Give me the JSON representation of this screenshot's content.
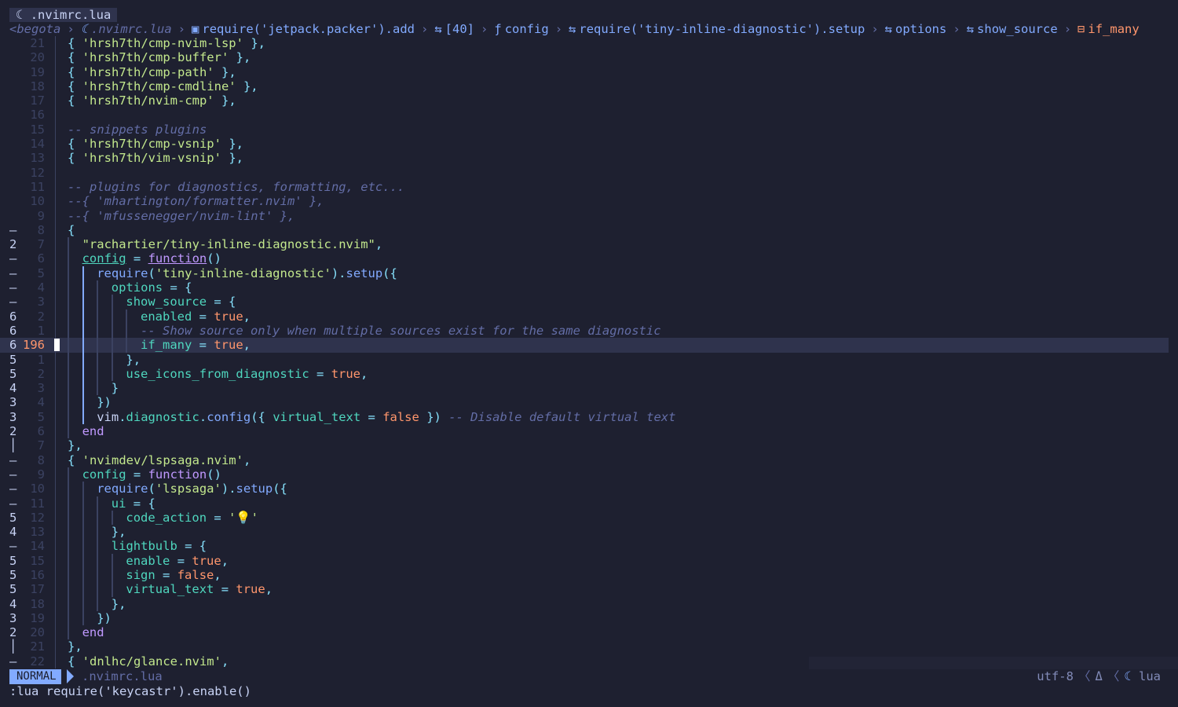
{
  "tab": {
    "title": ".nvimrc.lua"
  },
  "breadcrumb": {
    "items": [
      {
        "icon": "",
        "text": "<begota",
        "dim": true
      },
      {
        "icon": "lua-icon",
        "text": ".nvimrc.lua",
        "dim": true
      },
      {
        "icon": "module-icon",
        "text": "require('jetpack.packer').add"
      },
      {
        "icon": "struct-icon",
        "text": "[40]"
      },
      {
        "icon": "function-icon",
        "text": "config"
      },
      {
        "icon": "struct-icon",
        "text": "require('tiny-inline-diagnostic').setup"
      },
      {
        "icon": "struct-icon",
        "text": "options"
      },
      {
        "icon": "struct-icon",
        "text": "show_source"
      },
      {
        "icon": "boolean-icon",
        "text": "if_many",
        "last": true
      }
    ]
  },
  "lines": [
    {
      "l": "",
      "n": "21",
      "code": [
        {
          "c": "p",
          "t": "{ "
        },
        {
          "c": "s",
          "t": "'hrsh7th/cmp-nvim-lsp'"
        },
        {
          "c": "p",
          "t": " },"
        }
      ]
    },
    {
      "l": "",
      "n": "20",
      "code": [
        {
          "c": "p",
          "t": "{ "
        },
        {
          "c": "s",
          "t": "'hrsh7th/cmp-buffer'"
        },
        {
          "c": "p",
          "t": " },"
        }
      ]
    },
    {
      "l": "",
      "n": "19",
      "code": [
        {
          "c": "p",
          "t": "{ "
        },
        {
          "c": "s",
          "t": "'hrsh7th/cmp-path'"
        },
        {
          "c": "p",
          "t": " },"
        }
      ]
    },
    {
      "l": "",
      "n": "18",
      "code": [
        {
          "c": "p",
          "t": "{ "
        },
        {
          "c": "s",
          "t": "'hrsh7th/cmp-cmdline'"
        },
        {
          "c": "p",
          "t": " },"
        }
      ]
    },
    {
      "l": "",
      "n": "17",
      "code": [
        {
          "c": "p",
          "t": "{ "
        },
        {
          "c": "s",
          "t": "'hrsh7th/nvim-cmp'"
        },
        {
          "c": "p",
          "t": " },"
        }
      ]
    },
    {
      "l": "",
      "n": "16",
      "code": []
    },
    {
      "l": "",
      "n": "15",
      "code": [
        {
          "c": "c",
          "t": "-- snippets plugins"
        }
      ]
    },
    {
      "l": "",
      "n": "14",
      "code": [
        {
          "c": "p",
          "t": "{ "
        },
        {
          "c": "s",
          "t": "'hrsh7th/cmp-vsnip'"
        },
        {
          "c": "p",
          "t": " },"
        }
      ]
    },
    {
      "l": "",
      "n": "13",
      "code": [
        {
          "c": "p",
          "t": "{ "
        },
        {
          "c": "s",
          "t": "'hrsh7th/vim-vsnip'"
        },
        {
          "c": "p",
          "t": " },"
        }
      ]
    },
    {
      "l": "",
      "n": "12",
      "code": []
    },
    {
      "l": "",
      "n": "11",
      "code": [
        {
          "c": "c",
          "t": "-- plugins for diagnostics, formatting, etc..."
        }
      ]
    },
    {
      "l": "",
      "n": "10",
      "code": [
        {
          "c": "c",
          "t": "--{ 'mhartington/formatter.nvim' },"
        }
      ]
    },
    {
      "l": "",
      "n": "9",
      "code": [
        {
          "c": "c",
          "t": "--{ 'mfussenegger/nvim-lint' },"
        }
      ]
    },
    {
      "l": "–",
      "n": "8",
      "code": [
        {
          "c": "p",
          "t": "{"
        }
      ]
    },
    {
      "l": "2",
      "n": "7",
      "code": [
        {
          "c": "s",
          "t": "\"rachartier/tiny-inline-diagnostic.nvim\""
        },
        {
          "c": "p",
          "t": ","
        }
      ]
    },
    {
      "l": "–",
      "n": "6",
      "code": [
        {
          "c": "t u",
          "t": "config"
        },
        {
          "c": "p",
          "t": " = "
        },
        {
          "c": "k u",
          "t": "function"
        },
        {
          "c": "p",
          "t": "()"
        }
      ]
    },
    {
      "l": "–",
      "n": "5",
      "code": [
        {
          "c": "f",
          "t": "require"
        },
        {
          "c": "p",
          "t": "("
        },
        {
          "c": "s",
          "t": "'tiny-inline-diagnostic'"
        },
        {
          "c": "p",
          "t": ")."
        },
        {
          "c": "f",
          "t": "setup"
        },
        {
          "c": "p",
          "t": "({"
        }
      ]
    },
    {
      "l": "–",
      "n": "4",
      "code": [
        {
          "c": "t",
          "t": "options"
        },
        {
          "c": "p",
          "t": " = {"
        }
      ]
    },
    {
      "l": "–",
      "n": "3",
      "code": [
        {
          "c": "t",
          "t": "show_source"
        },
        {
          "c": "p",
          "t": " = {"
        }
      ]
    },
    {
      "l": "6",
      "n": "2",
      "code": [
        {
          "c": "t",
          "t": "enabled"
        },
        {
          "c": "p",
          "t": " = "
        },
        {
          "c": "b",
          "t": "true"
        },
        {
          "c": "p",
          "t": ","
        }
      ]
    },
    {
      "l": "6",
      "n": "1",
      "code": [
        {
          "c": "c",
          "t": "-- Show source only when multiple sources exist for the same diagnostic"
        }
      ]
    },
    {
      "l": "6",
      "n": "196",
      "cur": true,
      "code": [
        {
          "c": "t",
          "t": "if_many"
        },
        {
          "c": "p",
          "t": " = "
        },
        {
          "c": "b",
          "t": "true"
        },
        {
          "c": "p",
          "t": ","
        }
      ]
    },
    {
      "l": "5",
      "n": "1",
      "code": [
        {
          "c": "p",
          "t": "},"
        }
      ]
    },
    {
      "l": "5",
      "n": "2",
      "code": [
        {
          "c": "t",
          "t": "use_icons_from_diagnostic"
        },
        {
          "c": "p",
          "t": " = "
        },
        {
          "c": "b",
          "t": "true"
        },
        {
          "c": "p",
          "t": ","
        }
      ]
    },
    {
      "l": "4",
      "n": "3",
      "code": [
        {
          "c": "p",
          "t": "}"
        }
      ]
    },
    {
      "l": "3",
      "n": "4",
      "code": [
        {
          "c": "p",
          "t": "})"
        }
      ]
    },
    {
      "l": "3",
      "n": "5",
      "code": [
        {
          "c": "fl",
          "t": "vim"
        },
        {
          "c": "p",
          "t": "."
        },
        {
          "c": "t",
          "t": "diagnostic"
        },
        {
          "c": "p",
          "t": "."
        },
        {
          "c": "f",
          "t": "config"
        },
        {
          "c": "p",
          "t": "({ "
        },
        {
          "c": "t",
          "t": "virtual_text"
        },
        {
          "c": "p",
          "t": " = "
        },
        {
          "c": "b",
          "t": "false"
        },
        {
          "c": "p",
          "t": " }) "
        },
        {
          "c": "c",
          "t": "-- Disable default virtual text"
        }
      ]
    },
    {
      "l": "2",
      "n": "6",
      "code": [
        {
          "c": "k",
          "t": "end"
        }
      ]
    },
    {
      "l": "│",
      "n": "7",
      "code": [
        {
          "c": "p",
          "t": "},"
        }
      ]
    },
    {
      "l": "–",
      "n": "8",
      "code": [
        {
          "c": "p",
          "t": "{ "
        },
        {
          "c": "s",
          "t": "'nvimdev/lspsaga.nvim'"
        },
        {
          "c": "p",
          "t": ","
        }
      ]
    },
    {
      "l": "–",
      "n": "9",
      "code": [
        {
          "c": "t",
          "t": "config"
        },
        {
          "c": "p",
          "t": " = "
        },
        {
          "c": "k",
          "t": "function"
        },
        {
          "c": "p",
          "t": "()"
        }
      ]
    },
    {
      "l": "–",
      "n": "10",
      "code": [
        {
          "c": "f",
          "t": "require"
        },
        {
          "c": "p",
          "t": "("
        },
        {
          "c": "s",
          "t": "'lspsaga'"
        },
        {
          "c": "p",
          "t": ")."
        },
        {
          "c": "f",
          "t": "setup"
        },
        {
          "c": "p",
          "t": "({"
        }
      ]
    },
    {
      "l": "–",
      "n": "11",
      "code": [
        {
          "c": "t",
          "t": "ui"
        },
        {
          "c": "p",
          "t": " = {"
        }
      ]
    },
    {
      "l": "5",
      "n": "12",
      "code": [
        {
          "c": "t",
          "t": "code_action"
        },
        {
          "c": "p",
          "t": " = "
        },
        {
          "c": "s",
          "t": "'💡'"
        }
      ]
    },
    {
      "l": "4",
      "n": "13",
      "code": [
        {
          "c": "p",
          "t": "},"
        }
      ]
    },
    {
      "l": "–",
      "n": "14",
      "code": [
        {
          "c": "t",
          "t": "lightbulb"
        },
        {
          "c": "p",
          "t": " = {"
        }
      ]
    },
    {
      "l": "5",
      "n": "15",
      "code": [
        {
          "c": "t",
          "t": "enable"
        },
        {
          "c": "p",
          "t": " = "
        },
        {
          "c": "b",
          "t": "true"
        },
        {
          "c": "p",
          "t": ","
        }
      ]
    },
    {
      "l": "5",
      "n": "16",
      "code": [
        {
          "c": "t",
          "t": "sign"
        },
        {
          "c": "p",
          "t": " = "
        },
        {
          "c": "b",
          "t": "false"
        },
        {
          "c": "p",
          "t": ","
        }
      ]
    },
    {
      "l": "5",
      "n": "17",
      "code": [
        {
          "c": "t",
          "t": "virtual_text"
        },
        {
          "c": "p",
          "t": " = "
        },
        {
          "c": "b",
          "t": "true"
        },
        {
          "c": "p",
          "t": ","
        }
      ]
    },
    {
      "l": "4",
      "n": "18",
      "code": [
        {
          "c": "p",
          "t": "},"
        }
      ]
    },
    {
      "l": "3",
      "n": "19",
      "code": [
        {
          "c": "p",
          "t": "})"
        }
      ]
    },
    {
      "l": "2",
      "n": "20",
      "code": [
        {
          "c": "k",
          "t": "end"
        }
      ]
    },
    {
      "l": "│",
      "n": "21",
      "code": [
        {
          "c": "p",
          "t": "},"
        }
      ]
    },
    {
      "l": "–",
      "n": "22",
      "code": [
        {
          "c": "p",
          "t": "{ "
        },
        {
          "c": "s",
          "t": "'dnlhc/glance.nvim'"
        },
        {
          "c": "p",
          "t": ","
        }
      ]
    }
  ],
  "statusline": {
    "mode": "NORMAL",
    "file": ".nvimrc.lua",
    "encoding": "utf-8",
    "delta": "Δ",
    "filetype": "lua"
  },
  "cmdline": ":lua require('keycastr').enable()"
}
